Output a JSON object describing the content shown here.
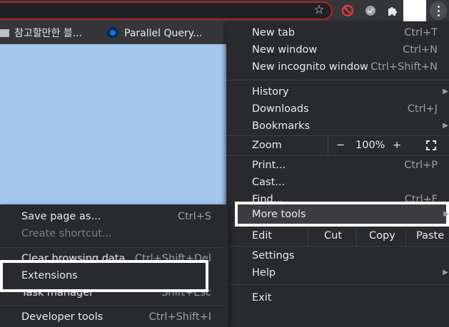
{
  "toolbar": {
    "star_icon": "star-icon",
    "extension_icons": [
      "block-icon",
      "gray-circle-icon",
      "puzzle-icon"
    ],
    "menu_icon": "kebab-icon"
  },
  "bookmarks": [
    {
      "label": "참고할만한 블...",
      "icon": "folder-icon"
    },
    {
      "label": "Parallel Query...",
      "icon": "circle-logo-icon"
    }
  ],
  "menu": {
    "new_tab": {
      "label": "New tab",
      "shortcut": "Ctrl+T"
    },
    "new_window": {
      "label": "New window",
      "shortcut": "Ctrl+N"
    },
    "new_incognito": {
      "label": "New incognito window",
      "shortcut": "Ctrl+Shift+N"
    },
    "history": {
      "label": "History"
    },
    "downloads": {
      "label": "Downloads",
      "shortcut": "Ctrl+J"
    },
    "bookmarks": {
      "label": "Bookmarks"
    },
    "zoom": {
      "label": "Zoom",
      "minus": "−",
      "value": "100%",
      "plus": "+"
    },
    "print": {
      "label": "Print...",
      "shortcut": "Ctrl+P"
    },
    "cast": {
      "label": "Cast..."
    },
    "find": {
      "label": "Find...",
      "shortcut": "Ctrl+F"
    },
    "more_tools": {
      "label": "More tools"
    },
    "edit": {
      "label": "Edit",
      "cut": "Cut",
      "copy": "Copy",
      "paste": "Paste"
    },
    "settings": {
      "label": "Settings"
    },
    "help": {
      "label": "Help"
    },
    "exit": {
      "label": "Exit"
    }
  },
  "submenu": {
    "save_page": {
      "label": "Save page as...",
      "shortcut": "Ctrl+S"
    },
    "create_shortcut": {
      "label": "Create shortcut..."
    },
    "clear_browsing": {
      "label": "Clear browsing data...",
      "shortcut": "Ctrl+Shift+Del"
    },
    "extensions": {
      "label": "Extensions"
    },
    "task_manager": {
      "label": "Task manager",
      "shortcut": "Shift+Esc"
    },
    "developer_tools": {
      "label": "Developer tools",
      "shortcut": "Ctrl+Shift+I"
    }
  },
  "colors": {
    "toolbar_bg": "#35363a",
    "menu_bg": "#292a2d",
    "page_bg": "#a3c7ef",
    "omnibox_border": "#b3261e",
    "highlight_border": "#ffffff"
  }
}
